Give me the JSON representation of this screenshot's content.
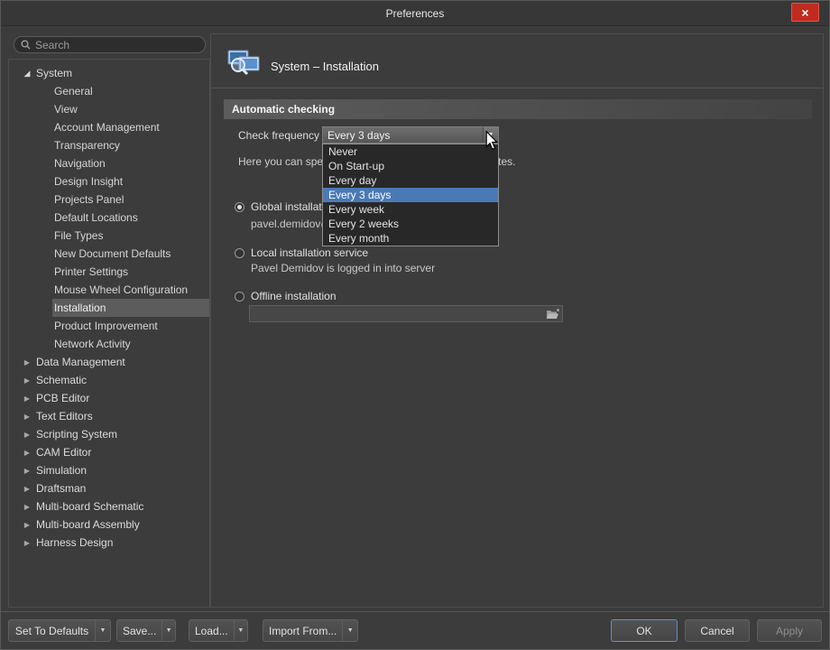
{
  "window": {
    "title": "Preferences",
    "close_glyph": "×"
  },
  "icons": {
    "expanded_glyph": "◢",
    "collapsed_glyph": "▶",
    "dropdown_arrow_glyph": "▼"
  },
  "sidebar": {
    "search_placeholder": "Search",
    "selected_item": "Installation",
    "items": [
      {
        "label": "System"
      },
      {
        "label": "General"
      },
      {
        "label": "View"
      },
      {
        "label": "Account Management"
      },
      {
        "label": "Transparency"
      },
      {
        "label": "Navigation"
      },
      {
        "label": "Design Insight"
      },
      {
        "label": "Projects Panel"
      },
      {
        "label": "Default Locations"
      },
      {
        "label": "File Types"
      },
      {
        "label": "New Document Defaults"
      },
      {
        "label": "Printer Settings"
      },
      {
        "label": "Mouse Wheel Configuration"
      },
      {
        "label": "Installation"
      },
      {
        "label": "Product Improvement"
      },
      {
        "label": "Network Activity"
      },
      {
        "label": "Data Management"
      },
      {
        "label": "Schematic"
      },
      {
        "label": "PCB Editor"
      },
      {
        "label": "Text Editors"
      },
      {
        "label": "Scripting System"
      },
      {
        "label": "CAM Editor"
      },
      {
        "label": "Simulation"
      },
      {
        "label": "Draftsman"
      },
      {
        "label": "Multi-board Schematic"
      },
      {
        "label": "Multi-board Assembly"
      },
      {
        "label": "Harness Design"
      }
    ]
  },
  "main": {
    "page_title": "System – Installation",
    "section_title": "Automatic checking",
    "check_frequency_label": "Check frequency",
    "check_frequency_value": "Every 3 days",
    "description": "Here you can specify how often to check for new updates.",
    "dropdown": {
      "options": [
        "Never",
        "On Start-up",
        "Every day",
        "Every 3 days",
        "Every week",
        "Every 2 weeks",
        "Every month"
      ],
      "selected": "Every 3 days"
    },
    "install_options": [
      {
        "label": "Global installation service",
        "sub": "pavel.demidov@",
        "selected": true
      },
      {
        "label": "Local installation service",
        "sub": "Pavel Demidov is logged in into server",
        "selected": false
      },
      {
        "label": "Offline installation",
        "sub": "",
        "selected": false
      }
    ],
    "offline_path_value": ""
  },
  "footer": {
    "set_to_defaults": "Set To Defaults",
    "save": "Save...",
    "load": "Load...",
    "import_from": "Import From...",
    "ok": "OK",
    "cancel": "Cancel",
    "apply": "Apply"
  },
  "colors": {
    "selection_blue": "#4a7ab5",
    "ok_border_blue": "#5a8fd6",
    "close_red": "#c02b1f"
  }
}
